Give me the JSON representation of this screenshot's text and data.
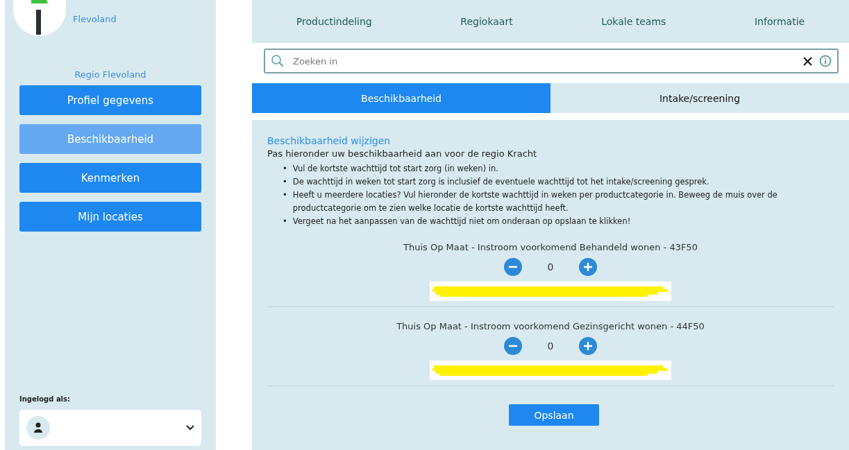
{
  "sidebar": {
    "region_short": "Flevoland",
    "region": "Regio Flevoland",
    "items": [
      {
        "label": "Profiel gegevens",
        "selected": false
      },
      {
        "label": "Beschikbaarheid",
        "selected": true
      },
      {
        "label": "Kenmerken",
        "selected": false
      },
      {
        "label": "Mijn locaties",
        "selected": false
      }
    ],
    "logged_in_label": "Ingelogd als:"
  },
  "nav": [
    "Productindeling",
    "Regiokaart",
    "Lokale teams",
    "Informatie"
  ],
  "search": {
    "placeholder": "Zoeken in"
  },
  "tabs": [
    {
      "label": "Beschikbaarheid",
      "selected": true
    },
    {
      "label": "Intake/screening",
      "selected": false
    }
  ],
  "content": {
    "title": "Beschikbaarheid wijzigen",
    "intro": "Pas hieronder uw beschikbaarheid aan voor de regio Kracht",
    "bullets": [
      {
        "marker": "•",
        "text": "Vul de kortste wachttijd tot start zorg (in weken) in."
      },
      {
        "marker": "•",
        "text": "De wachttijd in weken tot start zorg is inclusief de eventuele wachttijd tot het intake/screening gesprek."
      },
      {
        "marker": "•",
        "text": "Heeft u meerdere locaties? Vul hieronder de kortste wachttijd in weken per productcategorie in. Beweeg de muis over de productcategorie om te zien welke locatie de kortste wachttijd heeft."
      },
      {
        "marker": "•",
        "text": "Vergeet na het aanpassen van de wachttijd niet om onderaan op opslaan te klikken!"
      }
    ],
    "products": [
      {
        "name": "Thuis Op Maat - Instroom voorkomend Behandeld wonen - 43F50",
        "value": "0"
      },
      {
        "name": "Thuis Op Maat - Instroom voorkomend Gezinsgericht wonen - 44F50",
        "value": "0"
      }
    ],
    "save": "Opslaan"
  }
}
